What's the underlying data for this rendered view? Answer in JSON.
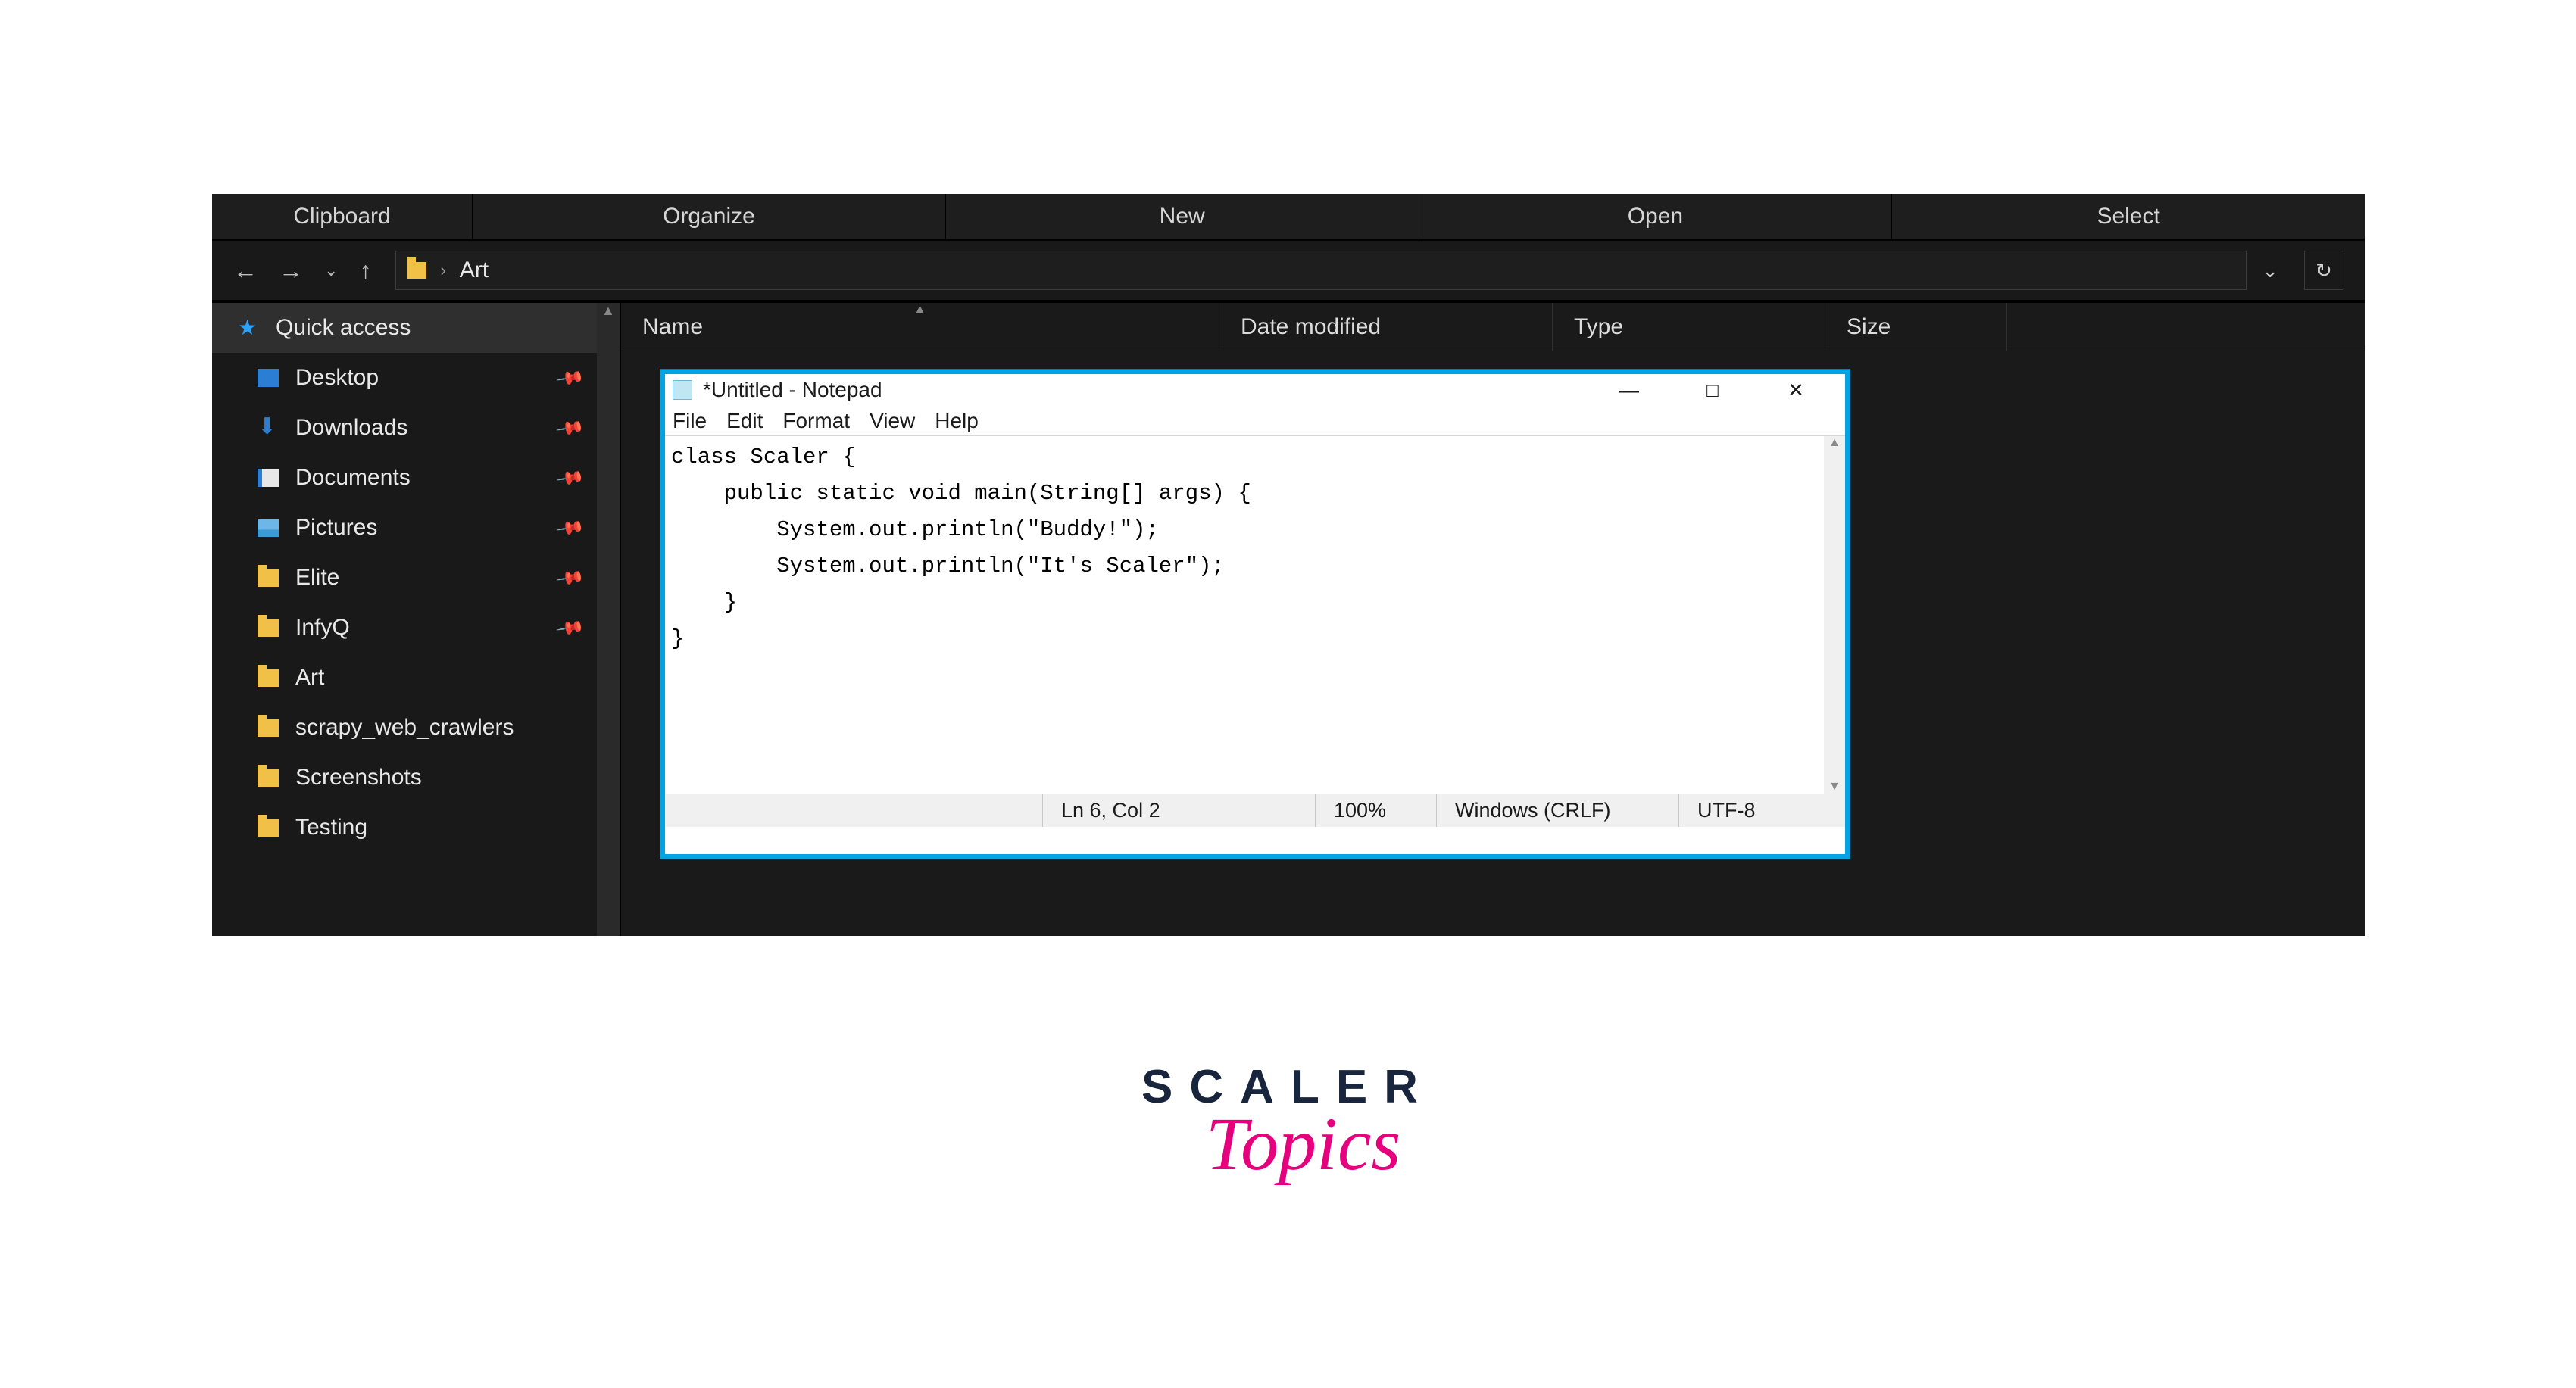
{
  "ribbon": {
    "groups": [
      "Clipboard",
      "Organize",
      "New",
      "Open",
      "Select"
    ]
  },
  "nav": {
    "crumb": "Art"
  },
  "sidebar": {
    "quick": "Quick access",
    "items": [
      {
        "label": "Desktop",
        "pinned": true,
        "icon": "desktop"
      },
      {
        "label": "Downloads",
        "pinned": true,
        "icon": "download"
      },
      {
        "label": "Documents",
        "pinned": true,
        "icon": "doc"
      },
      {
        "label": "Pictures",
        "pinned": true,
        "icon": "pic"
      },
      {
        "label": "Elite",
        "pinned": true,
        "icon": "folder"
      },
      {
        "label": "InfyQ",
        "pinned": true,
        "icon": "folder"
      },
      {
        "label": "Art",
        "pinned": false,
        "icon": "folder"
      },
      {
        "label": "scrapy_web_crawlers",
        "pinned": false,
        "icon": "folder"
      },
      {
        "label": "Screenshots",
        "pinned": false,
        "icon": "folder"
      },
      {
        "label": "Testing",
        "pinned": false,
        "icon": "folder"
      }
    ]
  },
  "columns": {
    "name": "Name",
    "date": "Date modified",
    "type": "Type",
    "size": "Size"
  },
  "notepad": {
    "title": "*Untitled - Notepad",
    "menu": [
      "File",
      "Edit",
      "Format",
      "View",
      "Help"
    ],
    "text": "class Scaler {\n    public static void main(String[] args) {\n        System.out.println(\"Buddy!\");\n        System.out.println(\"It's Scaler\");\n    }\n}",
    "status": {
      "pos": "Ln 6, Col 2",
      "zoom": "100%",
      "line_ending": "Windows (CRLF)",
      "encoding": "UTF-8"
    }
  },
  "brand": {
    "line1": "SCALER",
    "line2": "Topics"
  }
}
